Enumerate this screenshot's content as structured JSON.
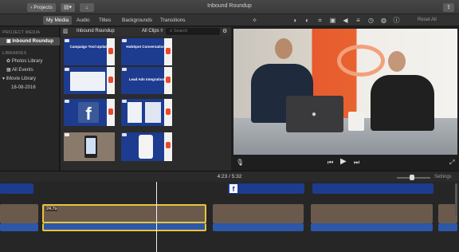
{
  "titlebar": {
    "projects_label": "‹ Projects",
    "window_title": "Inbound Roundup"
  },
  "toolbar": {
    "tabs": [
      "My Media",
      "Audio",
      "Titles",
      "Backgrounds",
      "Transitions"
    ],
    "active_tab": "My Media",
    "reset_all": "Reset All"
  },
  "sidebar": {
    "project_media_heading": "PROJECT MEDIA",
    "project_item": "Inbound Roundup",
    "libraries_heading": "LIBRARIES",
    "library_items": [
      "Photos Library",
      "All Events",
      "iMovie Library",
      "18-08-2016"
    ]
  },
  "browser": {
    "title": "Inbound Roundup",
    "filter": "All Clips ◊",
    "search_placeholder": "Search",
    "thumbnails": [
      {
        "caption": "Campaign Tool Update"
      },
      {
        "caption": "HubSpot Conversations"
      },
      {
        "caption": ""
      },
      {
        "caption": "Lead Ads Integration"
      },
      {
        "caption": ""
      },
      {
        "caption": ""
      },
      {
        "caption": ""
      },
      {
        "caption": ""
      }
    ]
  },
  "timeline": {
    "timecode": "4:23 / 5:32",
    "settings": "Settings",
    "clip_duration": "24.7s"
  },
  "colors": {
    "accent_blue": "#1d3b8f",
    "selection_yellow": "#e8c43a",
    "hubspot_orange": "#e8492b"
  }
}
